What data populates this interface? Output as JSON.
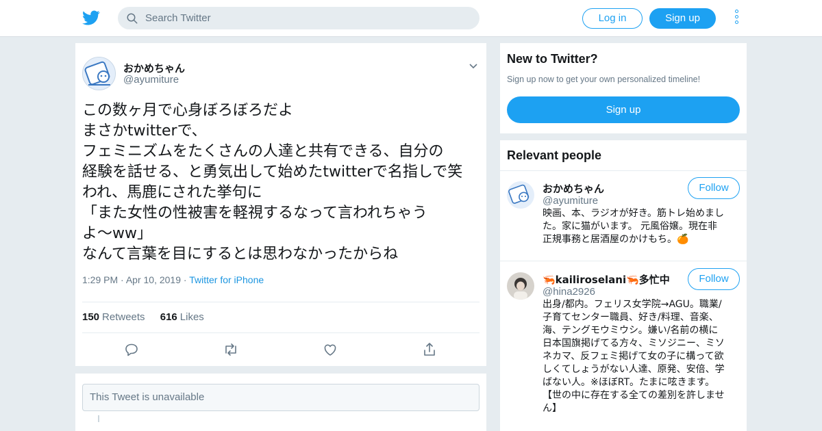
{
  "header": {
    "search_placeholder": "Search Twitter",
    "login_label": "Log in",
    "signup_label": "Sign up"
  },
  "tweet": {
    "author_name": "おかめちゃん",
    "author_handle": "@ayumiture",
    "text_lines": [
      "この数ヶ月で心身ぼろぼろだよ",
      "まさかtwitterで、",
      "フェミニズムをたくさんの人達と共有できる、自分の",
      "経験を話せる、と勇気出して始めたtwitterで名指しで笑",
      "われ、馬鹿にされた挙句に",
      "「また女性の性被害を軽視するなって言われちゃう",
      "よ〜ww」",
      "なんて言葉を目にするとは思わなかったからね"
    ],
    "time": "1:29 PM",
    "date": "Apr 10, 2019",
    "sep": "·",
    "source": "Twitter for iPhone",
    "retweets_count": "150",
    "retweets_label": "Retweets",
    "likes_count": "616",
    "likes_label": "Likes"
  },
  "unavailable_text": "This Tweet is unavailable",
  "sidebar": {
    "new_title": "New to Twitter?",
    "new_subtitle": "Sign up now to get your own personalized timeline!",
    "new_signup": "Sign up",
    "relevant_title": "Relevant people",
    "people": [
      {
        "name": "おかめちゃん",
        "handle": "@ayumiture",
        "follow": "Follow",
        "bio_lines": [
          "映画、本、ラジオが好き。筋トレ始めまし",
          "た。家に猫がいます。 元風俗嬢。現在非",
          "正規事務と居酒屋のかけもち。🍊"
        ]
      },
      {
        "name": "🦐kailiroselani🦐多忙中",
        "handle": "@hina2926",
        "follow": "Follow",
        "bio_lines": [
          "出身/都内。フェリス女学院→AGU。職業/",
          "子育てセンター職員、好き/料理、音楽、",
          "海、テングモウミウシ。嫌い/名前の横に",
          "日本国旗掲げてる方々、ミソジニー、ミソ",
          "ネカマ、反フェミ掲げて女の子に構って欲",
          "しくてしょうがない人達、原発、安倍、学",
          "ばない人。※ほぼRT。たまに呟きます。",
          "【世の中に存在する全ての差別を許しませ",
          "ん】"
        ]
      }
    ]
  },
  "colors": {
    "accent": "#1da1f2",
    "background": "#e6ecf0",
    "muted": "#657786"
  }
}
